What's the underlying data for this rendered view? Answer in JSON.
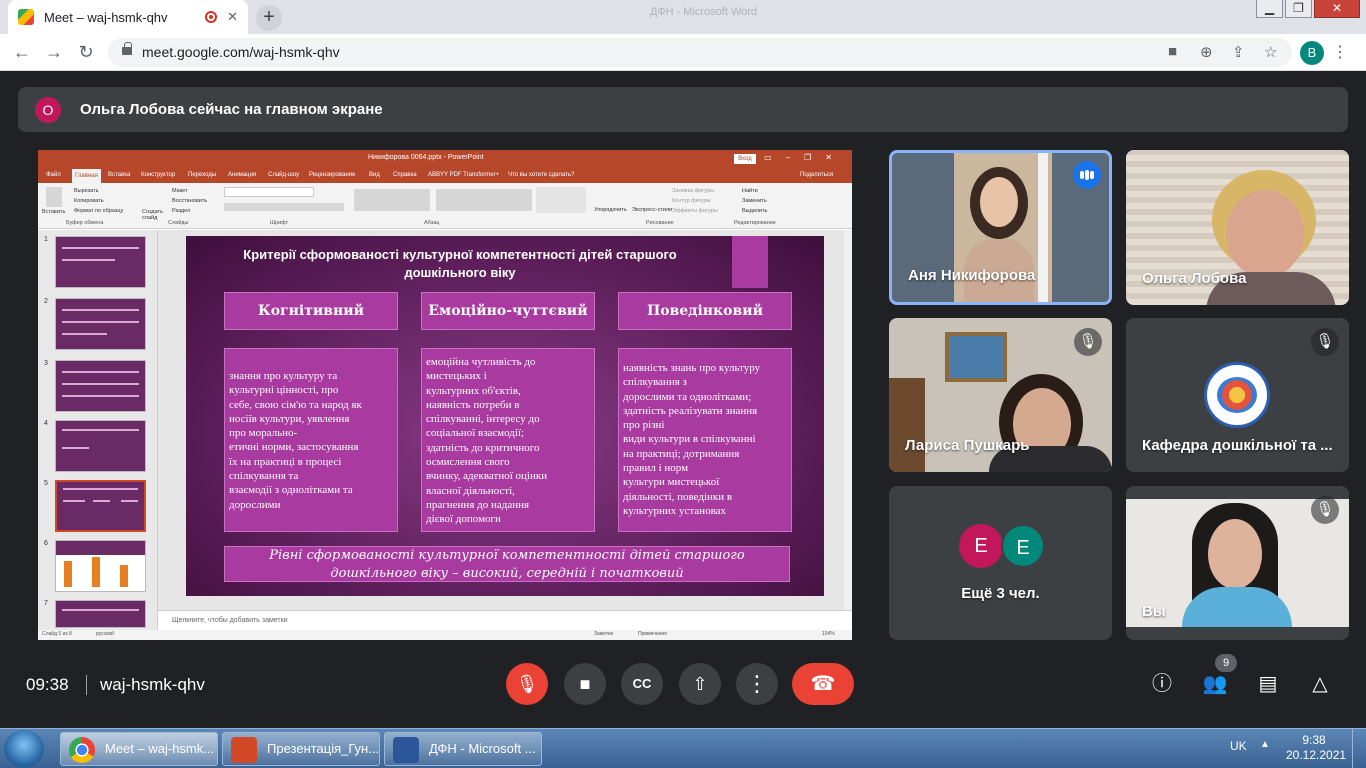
{
  "browser": {
    "tab_title": "Meet – waj-hsmk-qhv",
    "tab_close": "✕",
    "new_tab": "+",
    "background_window_title": "ДФН - Microsoft Word",
    "window_controls": [
      "▁",
      "❐",
      "✕"
    ],
    "url": "meet.google.com/waj-hsmk-qhv",
    "profile_initial": "B"
  },
  "banner": {
    "avatar_initial": "О",
    "text": "Ольга Лобова сейчас на главном экране"
  },
  "powerpoint": {
    "title": "Никифорова 0064.pptx - PowerPoint",
    "enter_button": "Вход",
    "menu": [
      "Файл",
      "Главная",
      "Вставка",
      "Конструктор",
      "Переходы",
      "Анимация",
      "Слайд-шоу",
      "Рецензирование",
      "Вид",
      "Справка",
      "ABBYY PDF Transformer+",
      "Что вы хотите сделать?",
      "Поделиться"
    ],
    "active_menu_index": 1,
    "ribbon_groups": [
      "Буфер обмена",
      "Слайды",
      "Шрифт",
      "Абзац",
      "Рисование",
      "Редактирование"
    ],
    "ribbon_items": [
      "Вставить",
      "Вырезать",
      "Копировать",
      "Формат по образцу",
      "Создать слайд",
      "Макет",
      "Восстановить",
      "Раздел",
      "Упорядочить",
      "Экспресс-стили",
      "Заливка фигуры",
      "Контур фигуры",
      "Эффекты фигуры",
      "Найти",
      "Заменить",
      "Выделить"
    ],
    "thumb_numbers": [
      "1",
      "2",
      "3",
      "4",
      "5",
      "6",
      "7"
    ],
    "notes_placeholder": "Щелкните, чтобы добавить заметки",
    "status_left": "Слайд 5 из 8",
    "status_lang": "русский",
    "status_notes": "Заметки",
    "status_comments": "Примечания",
    "zoom": "104%"
  },
  "slide": {
    "title": "Критерії сформованості культурної компетентності дітей старшого дошкільного віку",
    "columns": [
      {
        "header": "Когнітивний",
        "lines": [
          "знання про культуру та",
          "культурні цінності, про",
          "себе, свою сім'ю та народ як",
          "носіїв культури, уявлення",
          "про морально-",
          "етичні норми, застосування",
          "їх на практиці в процесі",
          "спілкування та",
          "взаємодії з однолітками та",
          "дорослими"
        ]
      },
      {
        "header": "Емоційно-чуттєвий",
        "lines": [
          "емоційна чутливість до",
          "мистецьких і",
          "культурних об'єктів,",
          "наявність потреби в",
          "спілкуванні, інтересу до",
          "соціальної взаємодії;",
          "здатність до критичного",
          "осмислення свого",
          "вчинку, адекватної оцінки",
          "власної діяльності,",
          "прагнення до надання",
          "дієвої допомоги"
        ]
      },
      {
        "header": "Поведінковий",
        "lines": [
          "наявність знань про культуру",
          "спілкування з",
          "дорослими та однолітками;",
          "здатність реалізувати знання",
          "про різні",
          "види культури в спілкуванні",
          "на практиці; дотримання",
          "правил і норм",
          "культури мистецької",
          "діяльності, поведінки в",
          "культурних установах"
        ]
      }
    ],
    "footer_line1": "Рівні сформованості культурної компетентності дітей старшого",
    "footer_line2": "дошкільного віку – високий, середній і початковий"
  },
  "participants": [
    {
      "name": "Аня Никифорова",
      "state": "speaking"
    },
    {
      "name": "Ольга Лобова",
      "state": "unmuted"
    },
    {
      "name": "Лариса Пушкарь",
      "state": "muted"
    },
    {
      "name": "Кафедра дошкільної та ...",
      "state": "muted"
    },
    {
      "name": "Ещё 3 чел.",
      "avatars": [
        "Е",
        "Е"
      ],
      "colors": [
        "#c2185b",
        "#00897b"
      ]
    },
    {
      "name": "Вы",
      "state": "muted"
    }
  ],
  "meeting": {
    "time": "09:38",
    "code": "waj-hsmk-qhv",
    "participant_count": "9"
  },
  "taskbar": {
    "buttons": [
      "Meet – waj-hsmk...",
      "Презентація_Гун...",
      "ДФН - Microsoft ..."
    ],
    "lang": "UK",
    "time": "9:38",
    "date": "20.12.2021"
  },
  "colors": {
    "meet_bg": "#202124",
    "slide_purple": "#a83aa0",
    "hangup_red": "#ea4335",
    "active_speaker": "#8ab4f8",
    "powerpoint_red": "#b7472a"
  }
}
